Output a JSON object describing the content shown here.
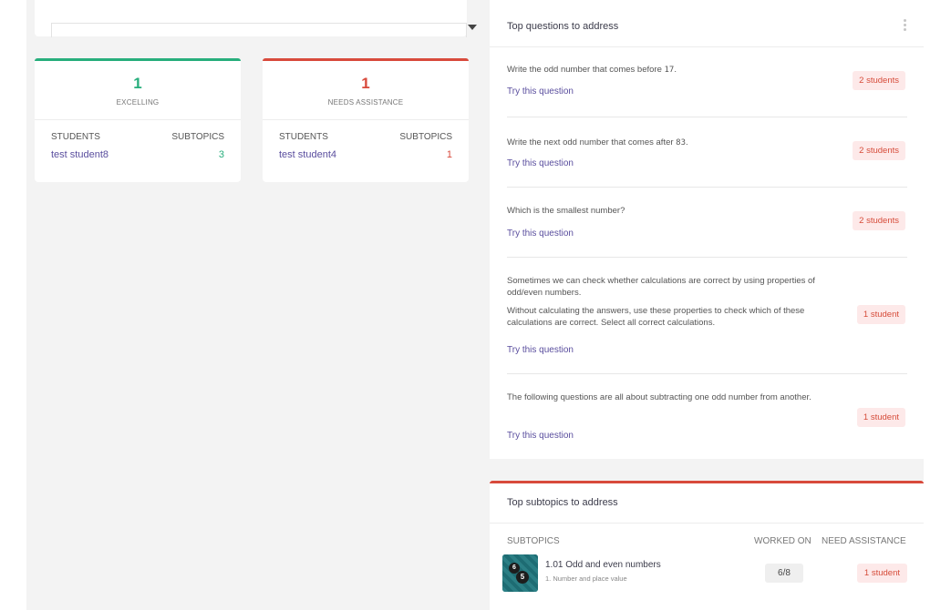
{
  "colors": {
    "excelling": "#27ae7c",
    "needs_assistance": "#d84a3c",
    "link": "#5a4e9e",
    "badge_bg": "#fde9e9"
  },
  "cards": [
    {
      "count": "1",
      "label": "EXCELLING",
      "col_students": "STUDENTS",
      "col_subtopics": "SUBTOPICS",
      "student": "test student8",
      "subtopics": "3"
    },
    {
      "count": "1",
      "label": "NEEDS ASSISTANCE",
      "col_students": "STUDENTS",
      "col_subtopics": "SUBTOPICS",
      "student": "test student4",
      "subtopics": "1"
    }
  ],
  "questions_panel": {
    "title": "Top questions to address",
    "menu_icon": "kebab-icon",
    "link_label": "Try this question",
    "items": [
      {
        "text_before": "Write the odd number that comes before ",
        "mono": "17",
        "text_after": ".",
        "badge": "2 students"
      },
      {
        "text_before": "Write the next odd number that comes after ",
        "mono": "83",
        "text_after": ".",
        "badge": "2 students"
      },
      {
        "text": "Which is the smallest number?",
        "badge": "2 students"
      },
      {
        "text_line1": "Sometimes we can check whether calculations are correct by using properties of odd/even numbers.",
        "text_line2": "Without calculating the answers, use these properties to check which of these calculations are correct. Select all correct calculations.",
        "badge": "1 student"
      },
      {
        "text": "The following questions are all about subtracting one odd number from another.",
        "badge": "1 student"
      }
    ]
  },
  "subtopics_panel": {
    "title": "Top subtopics to address",
    "col_subtopics": "SUBTOPICS",
    "col_worked_on": "WORKED ON",
    "col_need_assistance": "NEED ASSISTANCE",
    "rows": [
      {
        "thumb_balls": [
          "6",
          "5"
        ],
        "name": "1.01 Odd and even numbers",
        "topic": "1. Number and place value",
        "worked_on": "6/8",
        "need_assistance": "1 student"
      }
    ]
  }
}
